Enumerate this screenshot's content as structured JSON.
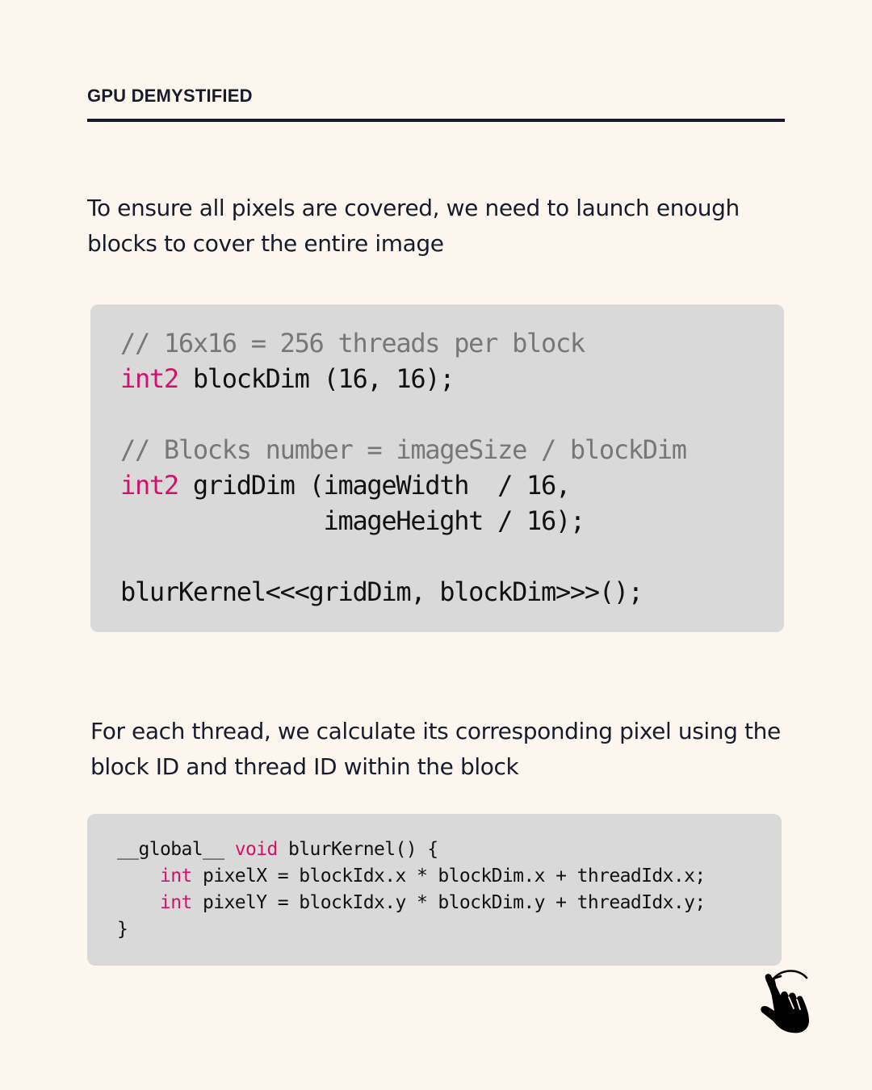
{
  "header": {
    "title": "GPU DEMYSTIFIED"
  },
  "intro": {
    "text": "To ensure all pixels are covered, we need to launch enough blocks to cover the entire image"
  },
  "code_launch": {
    "lines": [
      [
        {
          "text": "// 16x16 = 256 threads per block",
          "type": "comment"
        }
      ],
      [
        {
          "text": "int2",
          "type": "keyword"
        },
        {
          "text": " blockDim (16, 16);",
          "type": "code"
        }
      ],
      [],
      [
        {
          "text": "// Blocks number = imageSize / blockDim",
          "type": "comment"
        }
      ],
      [
        {
          "text": "int2",
          "type": "keyword"
        },
        {
          "text": " gridDim (imageWidth  / 16,",
          "type": "code"
        }
      ],
      [
        {
          "text": "              imageHeight / 16);",
          "type": "code"
        }
      ],
      [],
      [
        {
          "text": "blurKernel<<<gridDim, blockDim>>>();",
          "type": "code"
        }
      ]
    ]
  },
  "explanation": {
    "text": "For each thread, we calculate its corresponding pixel using the block ID and thread ID within the block"
  },
  "code_kernel": {
    "lines": [
      [
        {
          "text": "__global__ ",
          "type": "code"
        },
        {
          "text": "void",
          "type": "keyword"
        },
        {
          "text": " blurKernel() {",
          "type": "code"
        }
      ],
      [
        {
          "text": "    ",
          "type": "code"
        },
        {
          "text": "int",
          "type": "keyword"
        },
        {
          "text": " pixelX = blockIdx.x * blockDim.x + threadIdx.x;",
          "type": "code"
        }
      ],
      [
        {
          "text": "    ",
          "type": "code"
        },
        {
          "text": "int",
          "type": "keyword"
        },
        {
          "text": " pixelY = blockIdx.y * blockDim.y + threadIdx.y;",
          "type": "code"
        }
      ],
      [
        {
          "text": "}",
          "type": "code"
        }
      ]
    ]
  },
  "swipe_indicator": {
    "icon": "swipe-hand-icon"
  },
  "colors": {
    "background": "#fdf6ee",
    "text": "#161c2c",
    "code_background": "#d9d9d9",
    "keyword": "#d1126d",
    "comment": "#777777"
  }
}
